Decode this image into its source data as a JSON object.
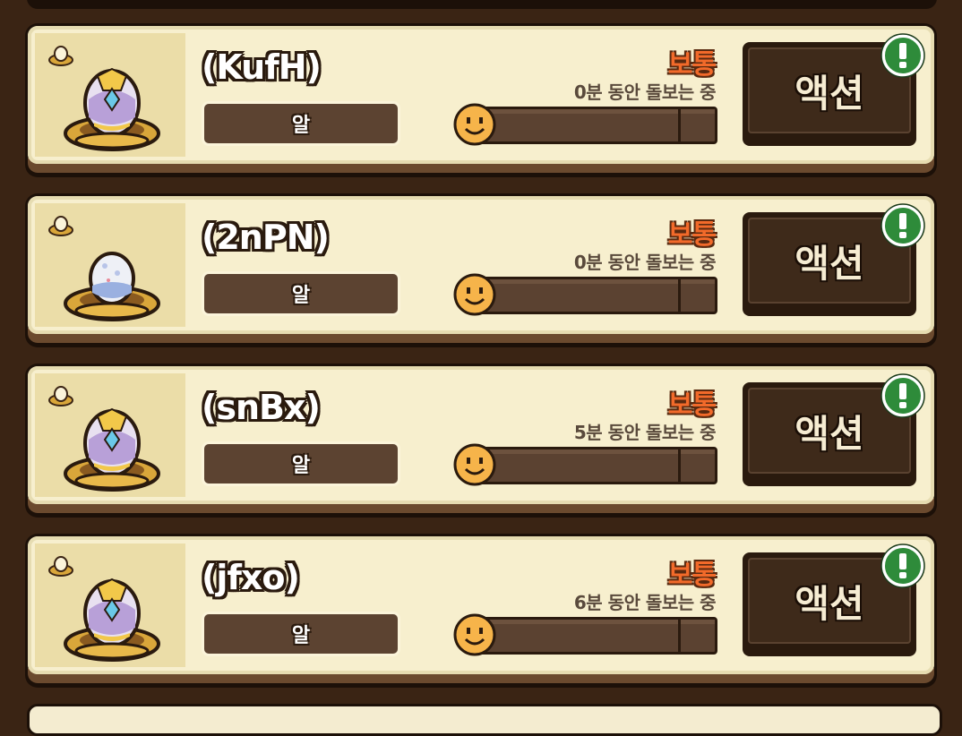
{
  "list": {
    "items": [
      {
        "name": "(KufH)",
        "stage": "알",
        "mood": "보통",
        "care_text": "0분 동안 돌보는 중",
        "progress": 0.02,
        "action_label": "액션",
        "alert_icon": "exclamation-icon",
        "egg": "ornate-egg"
      },
      {
        "name": "(2nPN)",
        "stage": "알",
        "mood": "보통",
        "care_text": "0분 동안 돌보는 중",
        "progress": 0.02,
        "action_label": "액션",
        "alert_icon": "exclamation-icon",
        "egg": "speckled-egg"
      },
      {
        "name": "(snBx)",
        "stage": "알",
        "mood": "보통",
        "care_text": "5분 동안 돌보는 중",
        "progress": 0.02,
        "action_label": "액션",
        "alert_icon": "exclamation-icon",
        "egg": "ornate-egg"
      },
      {
        "name": "(jfxo)",
        "stage": "알",
        "mood": "보통",
        "care_text": "6분 동안 돌보는 중",
        "progress": 0.02,
        "action_label": "액션",
        "alert_icon": "exclamation-icon",
        "egg": "ornate-egg"
      }
    ]
  },
  "colors": {
    "card_bg": "#f7efce",
    "mood_orange": "#f26a2a",
    "action_dark": "#3e2a1a",
    "alert_green": "#2e8b3a"
  }
}
